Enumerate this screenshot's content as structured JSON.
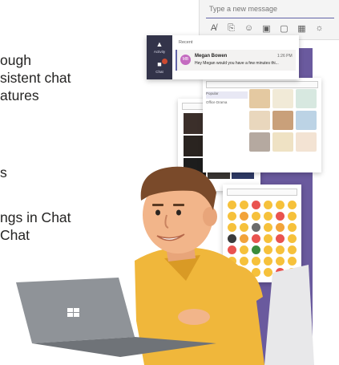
{
  "bullets": {
    "line1": "ough",
    "line2": "sistent chat",
    "line3": "atures",
    "line4": "s",
    "line5": "ngs in Chat",
    "line6": "Chat"
  },
  "compose": {
    "placeholder": "Type a new message",
    "tools": [
      "format-icon",
      "attach-icon",
      "emoji-icon",
      "gif-icon",
      "sticker-icon",
      "meet-icon",
      "more-icon"
    ]
  },
  "chat": {
    "rail_activity": "Activity",
    "rail_chat": "Chat",
    "recent_label": "Recent",
    "contact_name": "Megan Bowen",
    "contact_initials": "MB",
    "time": "1:26 PM",
    "preview": "Hey Megan would you have a few minutes thi..."
  },
  "stickers": {
    "search_placeholder": "Search",
    "categories": [
      "Popular",
      "Office Drama",
      "Popular reactions and more"
    ]
  },
  "gifs": {
    "search_placeholder": "Search"
  },
  "emoji": {
    "search_placeholder": "Search"
  },
  "colors": {
    "purple": "#6a5a9e",
    "rail": "#33344a",
    "accent": "#6264a7",
    "skin": "#f2b58a",
    "shirt": "#f0b73b",
    "laptop": "#8f9398"
  }
}
